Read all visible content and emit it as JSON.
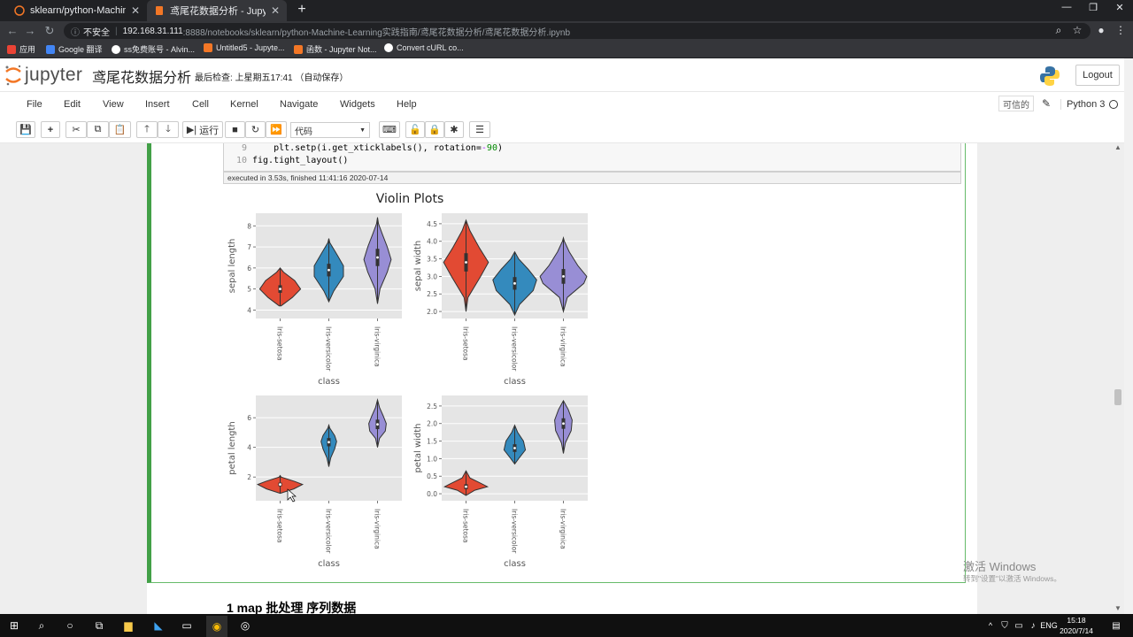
{
  "browser": {
    "tabs": [
      {
        "title": "sklearn/python-Machine-Lear",
        "active": false
      },
      {
        "title": "鸢尾花数据分析 - Jupyter Notel",
        "active": true
      }
    ],
    "security_label": "不安全",
    "url_host": "192.168.31.111",
    "url_rest": ":8888/notebooks/sklearn/python-Machine-Learning实践指南/鸢尾花数据分析/鸢尾花数据分析.ipynb",
    "bookmarks": [
      "应用",
      "Google 翻译",
      "ss免费账号 - Alvin...",
      "Untitled5 - Jupyte...",
      "函数 - Jupyter Not...",
      "Convert cURL co..."
    ]
  },
  "jupyter": {
    "logo_text": "jupyter",
    "notebook_name": "鸢尾花数据分析",
    "checkpoint": "最后检查: 上星期五17:41 （自动保存）",
    "logout": "Logout",
    "menu": [
      "File",
      "Edit",
      "View",
      "Insert",
      "Cell",
      "Kernel",
      "Navigate",
      "Widgets",
      "Help"
    ],
    "trusted": "可信的",
    "kernel": "Python 3",
    "run_label": "运行",
    "cell_type": "代码"
  },
  "code": {
    "lines": [
      {
        "n": "9",
        "text_a": "    plt.setp(i.get_xticklabels(), rotation=",
        "text_op": "-",
        "text_num": "90",
        "text_b": ")"
      },
      {
        "n": "10",
        "text_a": "fig.tight_layout()",
        "text_op": "",
        "text_num": "",
        "text_b": ""
      }
    ],
    "exec_info": "executed in 3.53s, finished 11:41:16 2020-07-14"
  },
  "chart_data": {
    "type": "violin",
    "title": "Violin Plots",
    "categories": [
      "Iris-setosa",
      "Iris-versicolor",
      "Iris-virginica"
    ],
    "colors": {
      "Iris-setosa": "#e24a33",
      "Iris-versicolor": "#348abd",
      "Iris-virginica": "#988ed5"
    },
    "subplots": [
      {
        "xlabel": "class",
        "ylabel": "sepal length",
        "yticks": [
          4,
          5,
          6,
          7,
          8
        ],
        "ylim": [
          3.6,
          8.6
        ],
        "medians": [
          5.0,
          5.9,
          6.5
        ]
      },
      {
        "xlabel": "class",
        "ylabel": "sepal width",
        "yticks": [
          2.0,
          2.5,
          3.0,
          3.5,
          4.0,
          4.5
        ],
        "ylim": [
          1.8,
          4.8
        ],
        "medians": [
          3.4,
          2.8,
          3.0
        ]
      },
      {
        "xlabel": "class",
        "ylabel": "petal length",
        "yticks": [
          2,
          4,
          6
        ],
        "ylim": [
          0.4,
          7.5
        ],
        "medians": [
          1.5,
          4.35,
          5.55
        ]
      },
      {
        "xlabel": "class",
        "ylabel": "petal width",
        "yticks": [
          0.0,
          0.5,
          1.0,
          1.5,
          2.0,
          2.5
        ],
        "ylim": [
          -0.2,
          2.8
        ],
        "medians": [
          0.2,
          1.3,
          2.0
        ]
      }
    ]
  },
  "section_heading": "1  map 批处理 序列数据",
  "watermark": {
    "line1": "激活 Windows",
    "line2": "转到\"设置\"以激活 Windows。"
  },
  "taskbar": {
    "time": "15:18",
    "date": "2020/7/14",
    "lang": "ENG"
  }
}
